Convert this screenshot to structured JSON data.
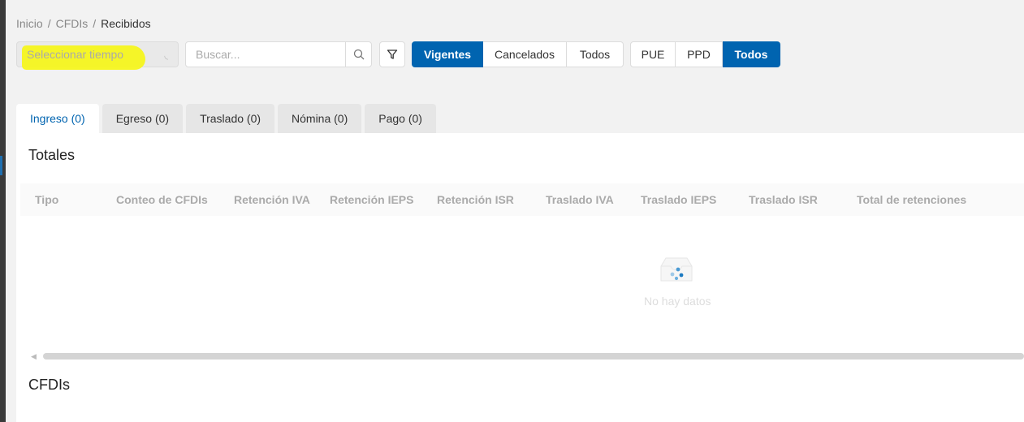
{
  "breadcrumb": {
    "items": [
      "Inicio",
      "CFDIs"
    ],
    "current": "Recibidos",
    "separator": "/"
  },
  "time_select": {
    "placeholder": "Seleccionar tiempo"
  },
  "search": {
    "placeholder": "Buscar..."
  },
  "status_filter": {
    "options": [
      "Vigentes",
      "Cancelados",
      "Todos"
    ],
    "selected": "Vigentes"
  },
  "payment_filter": {
    "options": [
      "PUE",
      "PPD",
      "Todos"
    ],
    "selected": "Todos"
  },
  "tabs": [
    {
      "label": "Ingreso (0)",
      "active": true
    },
    {
      "label": "Egreso (0)",
      "active": false
    },
    {
      "label": "Traslado (0)",
      "active": false
    },
    {
      "label": "Nómina (0)",
      "active": false
    },
    {
      "label": "Pago (0)",
      "active": false
    }
  ],
  "totals": {
    "title": "Totales",
    "columns": [
      "Tipo",
      "Conteo de CFDIs",
      "Retención IVA",
      "Retención IEPS",
      "Retención ISR",
      "Traslado IVA",
      "Traslado IEPS",
      "Traslado ISR",
      "Total de retenciones"
    ],
    "empty_text": "No hay datos"
  },
  "cfdis": {
    "title": "CFDIs"
  },
  "colors": {
    "primary": "#0064b0",
    "highlight": "#f5f51e"
  }
}
